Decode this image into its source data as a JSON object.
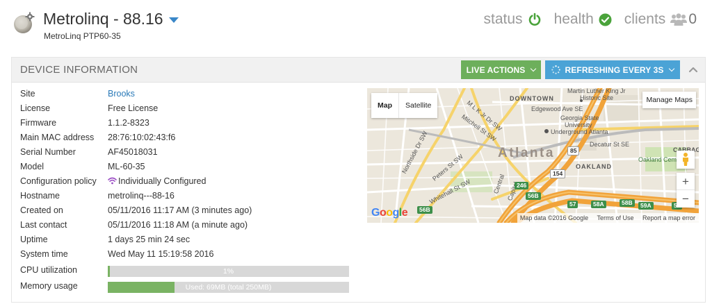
{
  "header": {
    "title": "Metrolinq - 88.16",
    "subtitle": "MetroLinq PTP60-35",
    "status_label": "status",
    "health_label": "health",
    "clients_label": "clients",
    "clients_count": "0"
  },
  "panel": {
    "title": "DEVICE INFORMATION",
    "live_actions": "LIVE ACTIONS",
    "refreshing": "REFRESHING EVERY 3S"
  },
  "info": [
    {
      "label": "Site",
      "value": "Brooks"
    },
    {
      "label": "License",
      "value": "Free License"
    },
    {
      "label": "Firmware",
      "value": "1.1.2-8323"
    },
    {
      "label": "Main MAC address",
      "value": "28:76:10:02:43:f6"
    },
    {
      "label": "Serial Number",
      "value": "AF45018031"
    },
    {
      "label": "Model",
      "value": "ML-60-35"
    },
    {
      "label": "Configuration policy",
      "value": "Individually Configured"
    },
    {
      "label": "Hostname",
      "value": "metrolinq---88-16"
    },
    {
      "label": "Created on",
      "value": "05/11/2016 11:17 AM (3 minutes ago)"
    },
    {
      "label": "Last contact",
      "value": "05/11/2016 11:18 AM (a minute ago)"
    },
    {
      "label": "Uptime",
      "value": "1 days 25 min 24 sec"
    },
    {
      "label": "System time",
      "value": "Wed May 11 15:19:58 2016"
    }
  ],
  "usage": {
    "cpu_label": "CPU utilization",
    "cpu_text": "1%",
    "cpu_fraction": 0.01,
    "mem_label": "Memory usage",
    "mem_text": "Used: 69MB (total 250MB)",
    "mem_fraction": 0.276
  },
  "map": {
    "tab_map": "Map",
    "tab_satellite": "Satellite",
    "manage": "Manage Maps",
    "zoom_in": "+",
    "zoom_out": "−",
    "attribution": "Map data ©2016 Google",
    "terms": "Terms of Use",
    "report": "Report a map error",
    "google": "Google",
    "city": "Atlanta",
    "labels": {
      "downtown": "DOWNTOWN",
      "mlk": "Martin Luther King Jr",
      "mlk2": "Historic Site",
      "edgewood": "Edgewood Ave SE",
      "gsu1": "Georgia State",
      "gsu2": "University",
      "underground": "Underground Atlanta",
      "decatur": "Decatur St SE",
      "oakland": "OAKLAND",
      "oakland_cem": "Oakland Cemetery",
      "cabbage": "CABBAG",
      "northside": "Northside Dr SW",
      "peters": "Peters St SW",
      "whitehall": "Whitehall St SW",
      "mlkjr": "M L K Jr Dr SW",
      "mitchell": "Mitchell St SW",
      "central": "Central",
      "capitol": "Capitol"
    },
    "shields": [
      "85",
      "154",
      "246",
      "56B",
      "56B",
      "57",
      "58A",
      "58B",
      "59A",
      "50"
    ]
  },
  "colors": {
    "live_actions": "#6daf5b",
    "refreshing": "#4ba3d6",
    "status_green": "#4aa33b",
    "link_blue": "#2a7ab8",
    "wifi_purple": "#9b4fc4"
  }
}
